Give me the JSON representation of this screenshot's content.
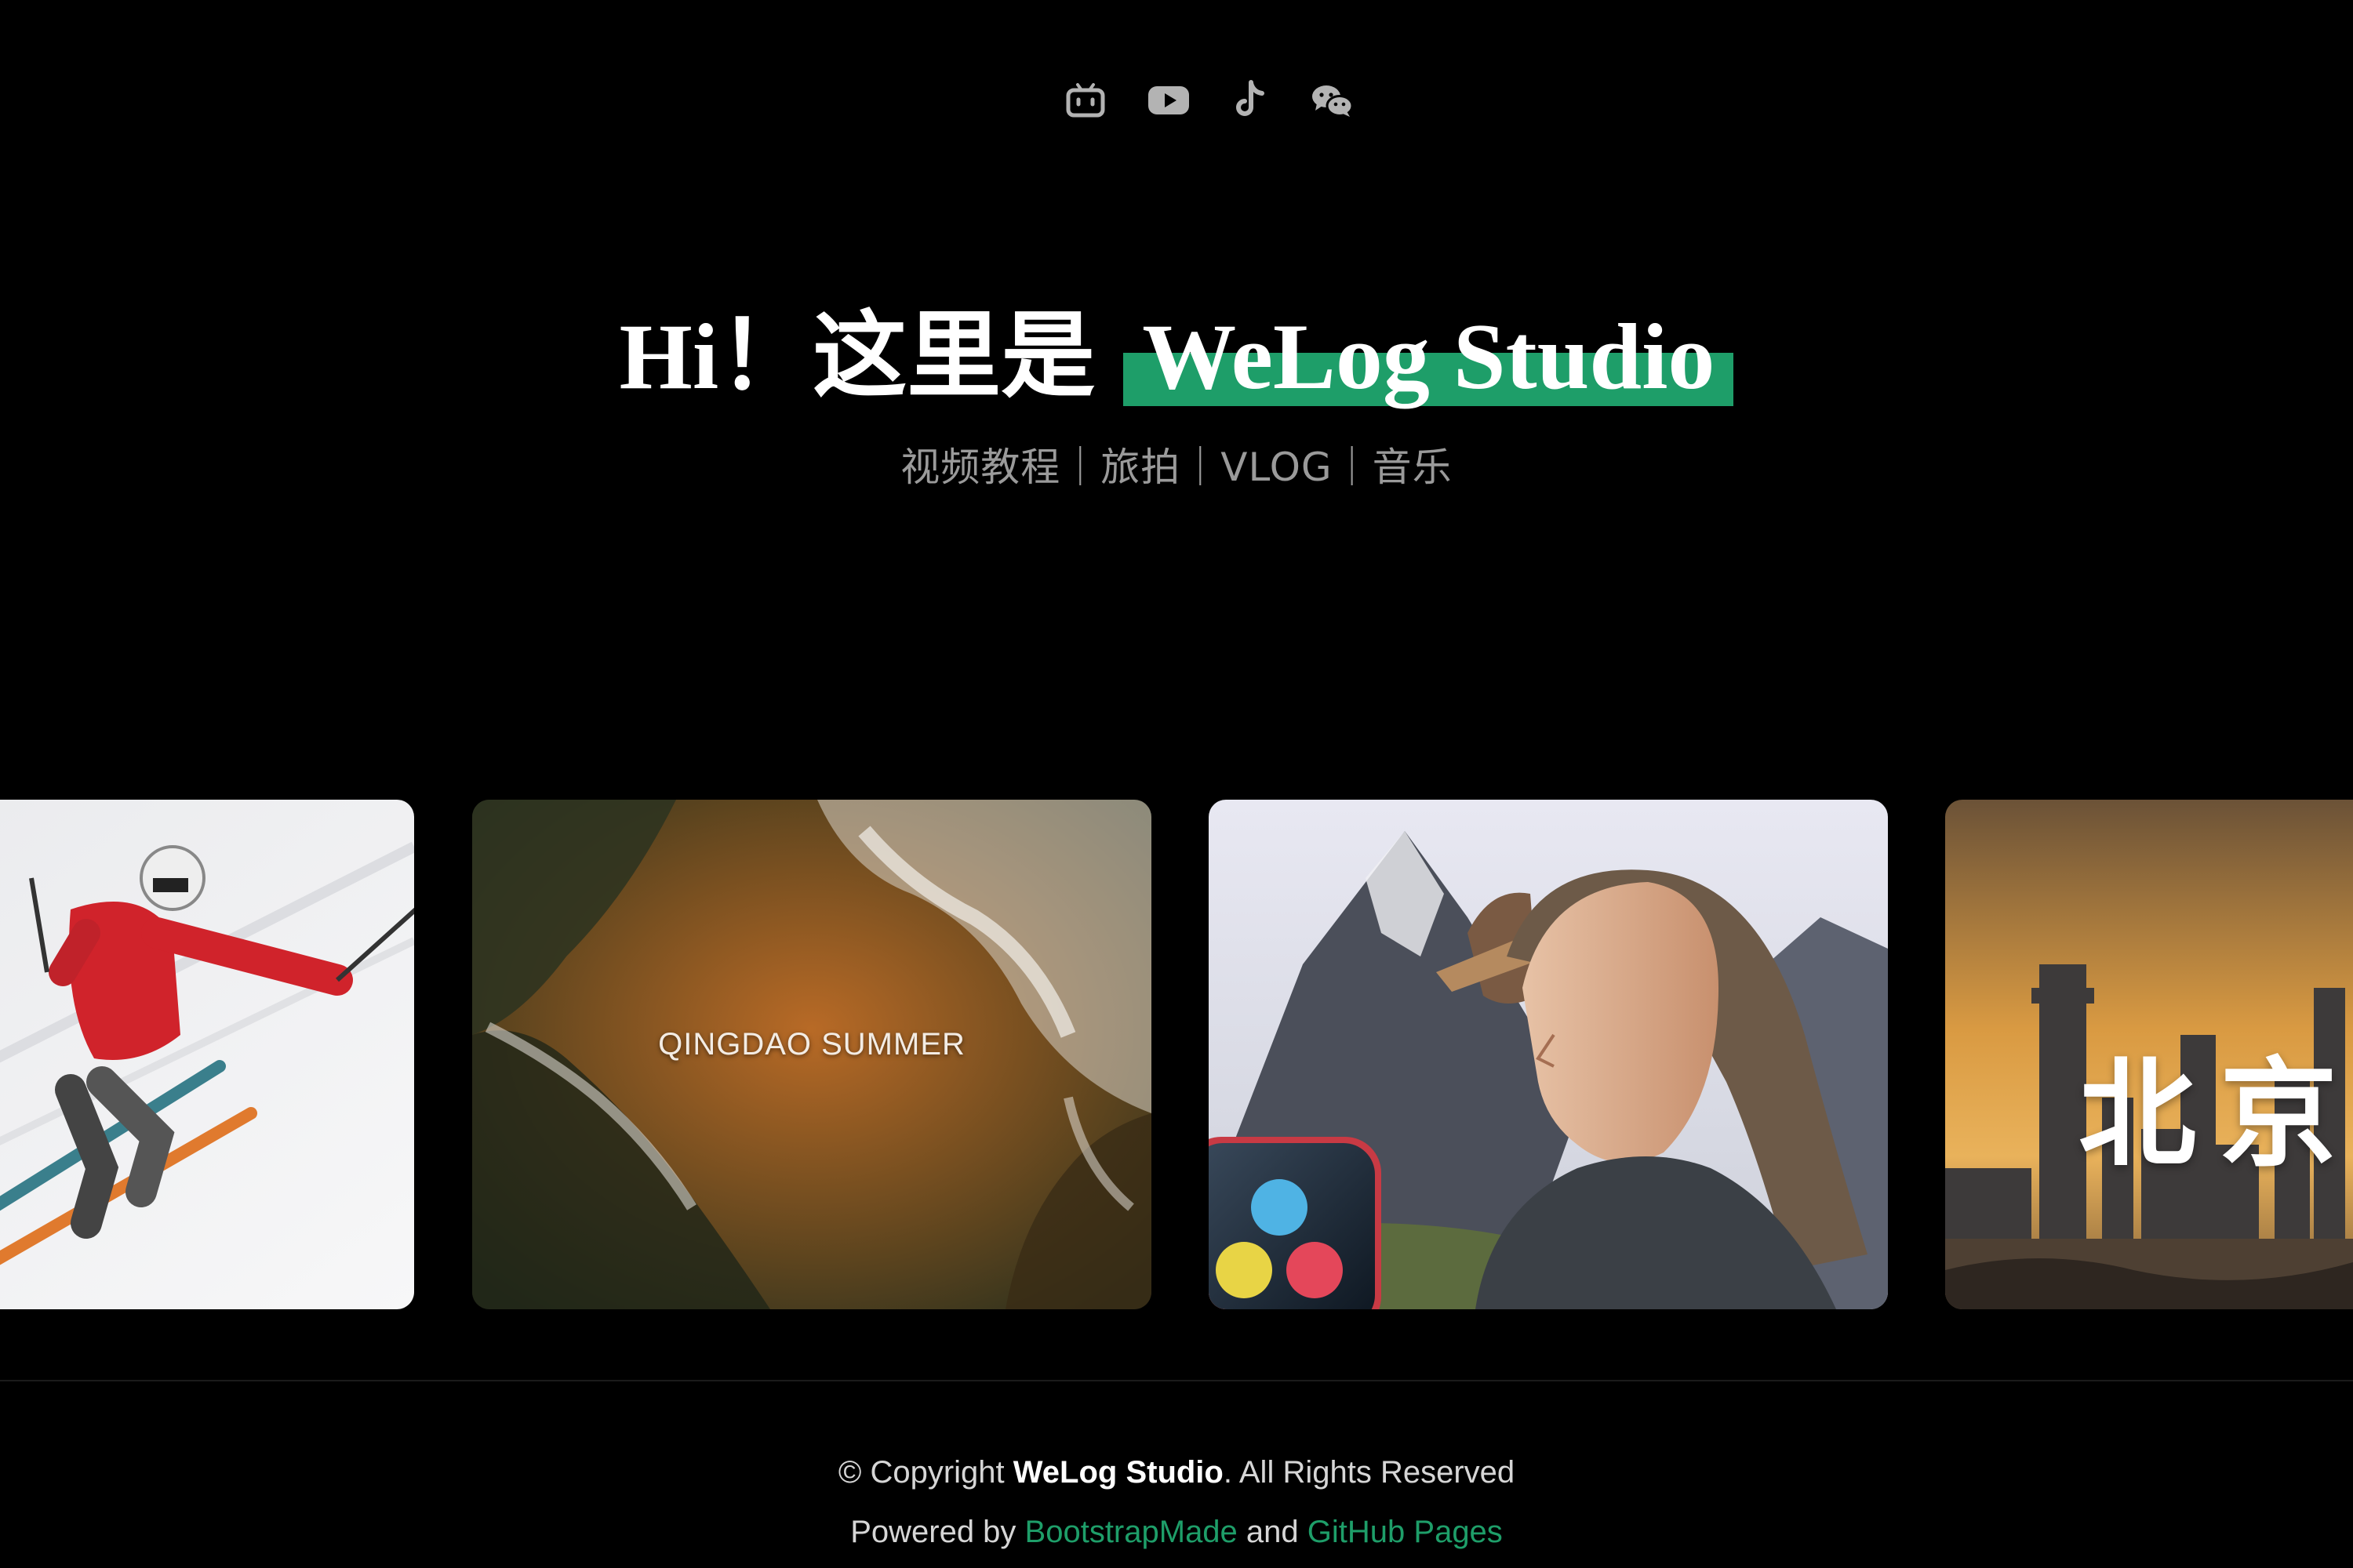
{
  "social": {
    "icons": [
      "bilibili-icon",
      "youtube-icon",
      "tiktok-icon",
      "wechat-icon"
    ]
  },
  "hero": {
    "greeting": "Hi！这里是",
    "brand": "WeLog Studio",
    "subtitle": "视频教程｜旅拍｜VLOG｜音乐",
    "highlight_color": "#1e9e69"
  },
  "carousel": {
    "cards": [
      {
        "image": "skier-photo",
        "caption": ""
      },
      {
        "image": "ocean-waves-aerial",
        "caption": "QINGDAO SUMMER"
      },
      {
        "image": "woman-mountain-davinci",
        "caption": ""
      },
      {
        "image": "beijing-skyline",
        "caption": "北京"
      }
    ]
  },
  "footer": {
    "copyright_prefix": "© Copyright ",
    "copyright_brand": "WeLog Studio",
    "copyright_suffix": ". All Rights Reserved",
    "powered_prefix": "Powered by ",
    "powered_link1": "BootstrapMade",
    "powered_and": " and ",
    "powered_link2": "GitHub Pages",
    "link_color": "#1e9e69"
  }
}
